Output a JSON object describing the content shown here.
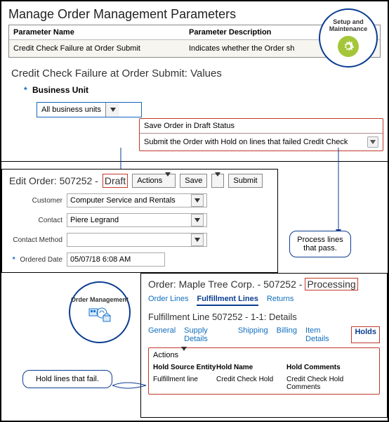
{
  "top": {
    "page_title": "Manage Order Management Parameters",
    "col_name": "Parameter Name",
    "col_desc": "Parameter Description",
    "row_name": "Credit Check Failure at Order Submit",
    "row_desc": "Indicates whether the Order sh",
    "subhead": "Credit Check Failure at Order Submit: Values",
    "bu_label": "Business Unit",
    "bu_value": "All business units",
    "option1": "Save Order in Draft Status",
    "option2": "Submit the Order with Hold on lines that failed Credit Check",
    "badge": "Setup and Maintenance"
  },
  "edit": {
    "title_prefix": "Edit Order: 507252 -",
    "status": "Draft",
    "actions_label": "Actions",
    "save_label": "Save",
    "submit_label": "Submit",
    "customer_label": "Customer",
    "customer_value": "Computer Service and Rentals",
    "contact_label": "Contact",
    "contact_value": "Piere Legrand",
    "method_label": "Contact Method",
    "date_label": "Ordered Date",
    "date_value": "05/07/18 6:08 AM"
  },
  "order": {
    "title_prefix": "Order: Maple Tree Corp. - 507252 -",
    "status": "Processing",
    "tabs": {
      "lines": "Order Lines",
      "fulfill": "Fulfillment Lines",
      "returns": "Returns"
    },
    "subhead": "Fulfillment Line 507252 - 1-1: Details",
    "subtabs": {
      "general": "General",
      "supply": "Supply Details",
      "shipping": "Shipping",
      "billing": "Billing",
      "item": "Item Details",
      "holds": "Holds"
    },
    "actions_label": "Actions",
    "cols": {
      "entity": "Hold Source Entity",
      "name": "Hold Name",
      "comments": "Hold Comments"
    },
    "row": {
      "entity": "Fulfillment line",
      "name": "Credit Check Hold",
      "comments": "Credit Check Hold Comments"
    }
  },
  "callouts": {
    "pass": "Process lines that pass.",
    "fail": "Hold lines that fail."
  },
  "badges": {
    "om": "Order Management"
  }
}
